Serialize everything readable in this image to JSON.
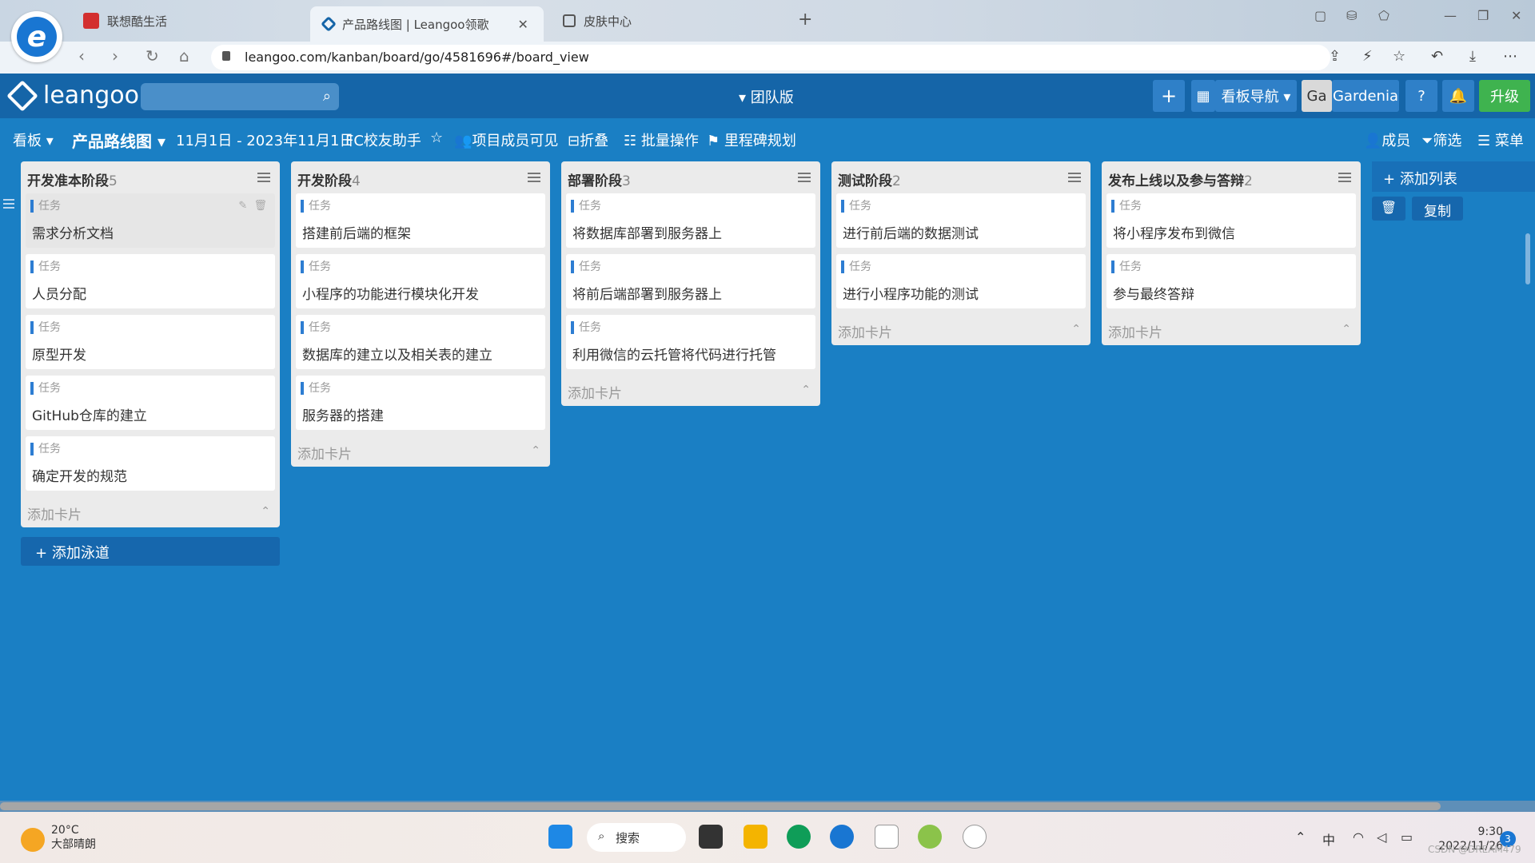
{
  "browser": {
    "tabs": [
      {
        "title": "联想酷生活"
      },
      {
        "title": "产品路线图 | Leangoo领歌"
      },
      {
        "title": "皮肤中心"
      }
    ],
    "url": "leangoo.com/kanban/board/go/4581696#/board_view"
  },
  "header": {
    "logo": "leangoo",
    "edition": "▾ 团队版",
    "plus": "+",
    "board_nav": "看板导航 ▾",
    "avatar": "Ga",
    "username": "Gardenia",
    "help": "?",
    "upgrade": "升级"
  },
  "toolbar": {
    "kanban": "看板 ▾",
    "board_name": "产品路线图 ▾",
    "date_range": "11月1日 - 2023年11月1日",
    "assistant": "FC校友助手",
    "visibility": "项目成员可见",
    "fold": "折叠",
    "batch": "批量操作",
    "milestone": "里程碑规划",
    "members": "成员",
    "filter": "筛选",
    "menu": "菜单"
  },
  "lists": [
    {
      "name": "开发准本阶段",
      "count": "5",
      "cards": [
        {
          "tag": "任务",
          "title": "需求分析文档"
        },
        {
          "tag": "任务",
          "title": "人员分配"
        },
        {
          "tag": "任务",
          "title": "原型开发"
        },
        {
          "tag": "任务",
          "title": "GitHub仓库的建立"
        },
        {
          "tag": "任务",
          "title": "确定开发的规范"
        }
      ]
    },
    {
      "name": "开发阶段",
      "count": "4",
      "cards": [
        {
          "tag": "任务",
          "title": "搭建前后端的框架"
        },
        {
          "tag": "任务",
          "title": "小程序的功能进行模块化开发"
        },
        {
          "tag": "任务",
          "title": "数据库的建立以及相关表的建立"
        },
        {
          "tag": "任务",
          "title": "服务器的搭建"
        }
      ]
    },
    {
      "name": "部署阶段",
      "count": "3",
      "cards": [
        {
          "tag": "任务",
          "title": "将数据库部署到服务器上"
        },
        {
          "tag": "任务",
          "title": "将前后端部署到服务器上"
        },
        {
          "tag": "任务",
          "title": "利用微信的云托管将代码进行托管"
        }
      ]
    },
    {
      "name": "测试阶段",
      "count": "2",
      "cards": [
        {
          "tag": "任务",
          "title": "进行前后端的数据测试"
        },
        {
          "tag": "任务",
          "title": "进行小程序功能的测试"
        }
      ]
    },
    {
      "name": "发布上线以及参与答辩",
      "count": "2",
      "cards": [
        {
          "tag": "任务",
          "title": "将小程序发布到微信"
        },
        {
          "tag": "任务",
          "title": "参与最终答辩"
        }
      ]
    }
  ],
  "add_card": "添加卡片",
  "add_swimlane": "添加泳道",
  "add_list": "添加列表",
  "copy": "复制",
  "taskbar": {
    "temp": "20°C",
    "weather": "大部晴朗",
    "search": "搜索",
    "ime": "中",
    "time": "9:30",
    "date": "2022/11/26",
    "notifications": "3",
    "watermark": "CSDN @DREAM479"
  }
}
